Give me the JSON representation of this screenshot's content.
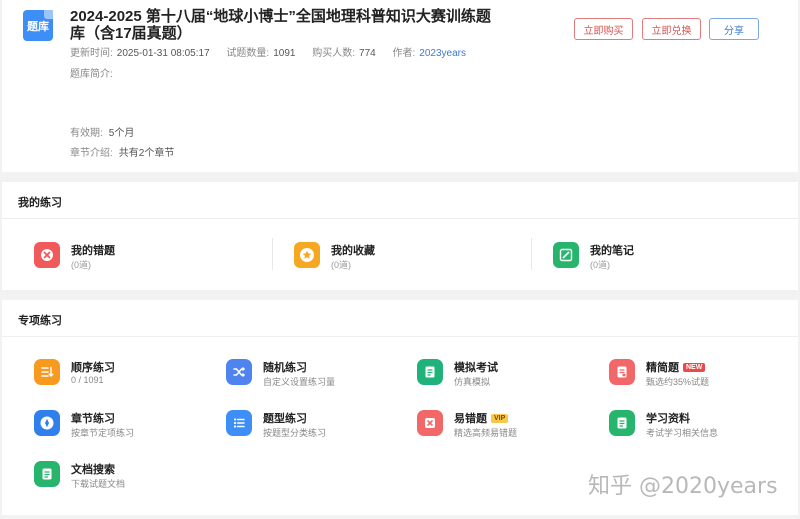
{
  "header": {
    "icon_label": "题库",
    "title": "2024-2025 第十八届“地球小博士”全国地理科普知识大赛训练题库（含17届真题）",
    "updated_label": "更新时间:",
    "updated_value": "2025-01-31 08:05:17",
    "count_label": "试题数量:",
    "count_value": "1091",
    "buyers_label": "购买人数:",
    "buyers_value": "774",
    "author_label": "作者:",
    "author_value": "2023years",
    "intro_label": "题库简介:",
    "validity_label": "有效期:",
    "validity_value": "5个月",
    "chapters_label": "章节介绍:",
    "chapters_value": "共有2个章节",
    "buttons": {
      "buy": "立即购买",
      "redeem": "立即兑换",
      "share": "分享"
    }
  },
  "my_practice": {
    "title": "我的练习",
    "items": [
      {
        "label": "我的错题",
        "sub": "(0道)",
        "icon": "close-circle-icon",
        "color": "#f05a5a"
      },
      {
        "label": "我的收藏",
        "sub": "(0道)",
        "icon": "star-icon",
        "color": "#f7a823"
      },
      {
        "label": "我的笔记",
        "sub": "(0道)",
        "icon": "pencil-icon",
        "color": "#27b46c"
      }
    ]
  },
  "special_practice": {
    "title": "专项练习",
    "items": [
      {
        "label": "顺序练习",
        "sub": "0 / 1091",
        "icon": "sort-list-icon",
        "color": "#f79a1f"
      },
      {
        "label": "随机练习",
        "sub": "自定义设置练习量",
        "icon": "shuffle-icon",
        "color": "#4f84f0"
      },
      {
        "label": "模拟考试",
        "sub": "仿真模拟",
        "icon": "exam-paper-icon",
        "color": "#1fb27a"
      },
      {
        "label": "精简题",
        "sub": "甄选约35%试题",
        "icon": "document-icon",
        "color": "#f26767",
        "badge": "NEW"
      },
      {
        "label": "章节练习",
        "sub": "按章节定项练习",
        "icon": "compass-icon",
        "color": "#2f80ed"
      },
      {
        "label": "题型练习",
        "sub": "按题型分类练习",
        "icon": "list-icon",
        "color": "#3d8ef7"
      },
      {
        "label": "易错题",
        "sub": "精选高频易错题",
        "icon": "close-square-icon",
        "color": "#f26767",
        "badge": "VIP"
      },
      {
        "label": "学习资料",
        "sub": "考试学习相关信息",
        "icon": "file-text-icon",
        "color": "#27b46c"
      },
      {
        "label": "文档搜索",
        "sub": "下载试题文档",
        "icon": "file-search-icon",
        "color": "#27b46c"
      }
    ]
  },
  "watermark": "知乎 @2020years"
}
